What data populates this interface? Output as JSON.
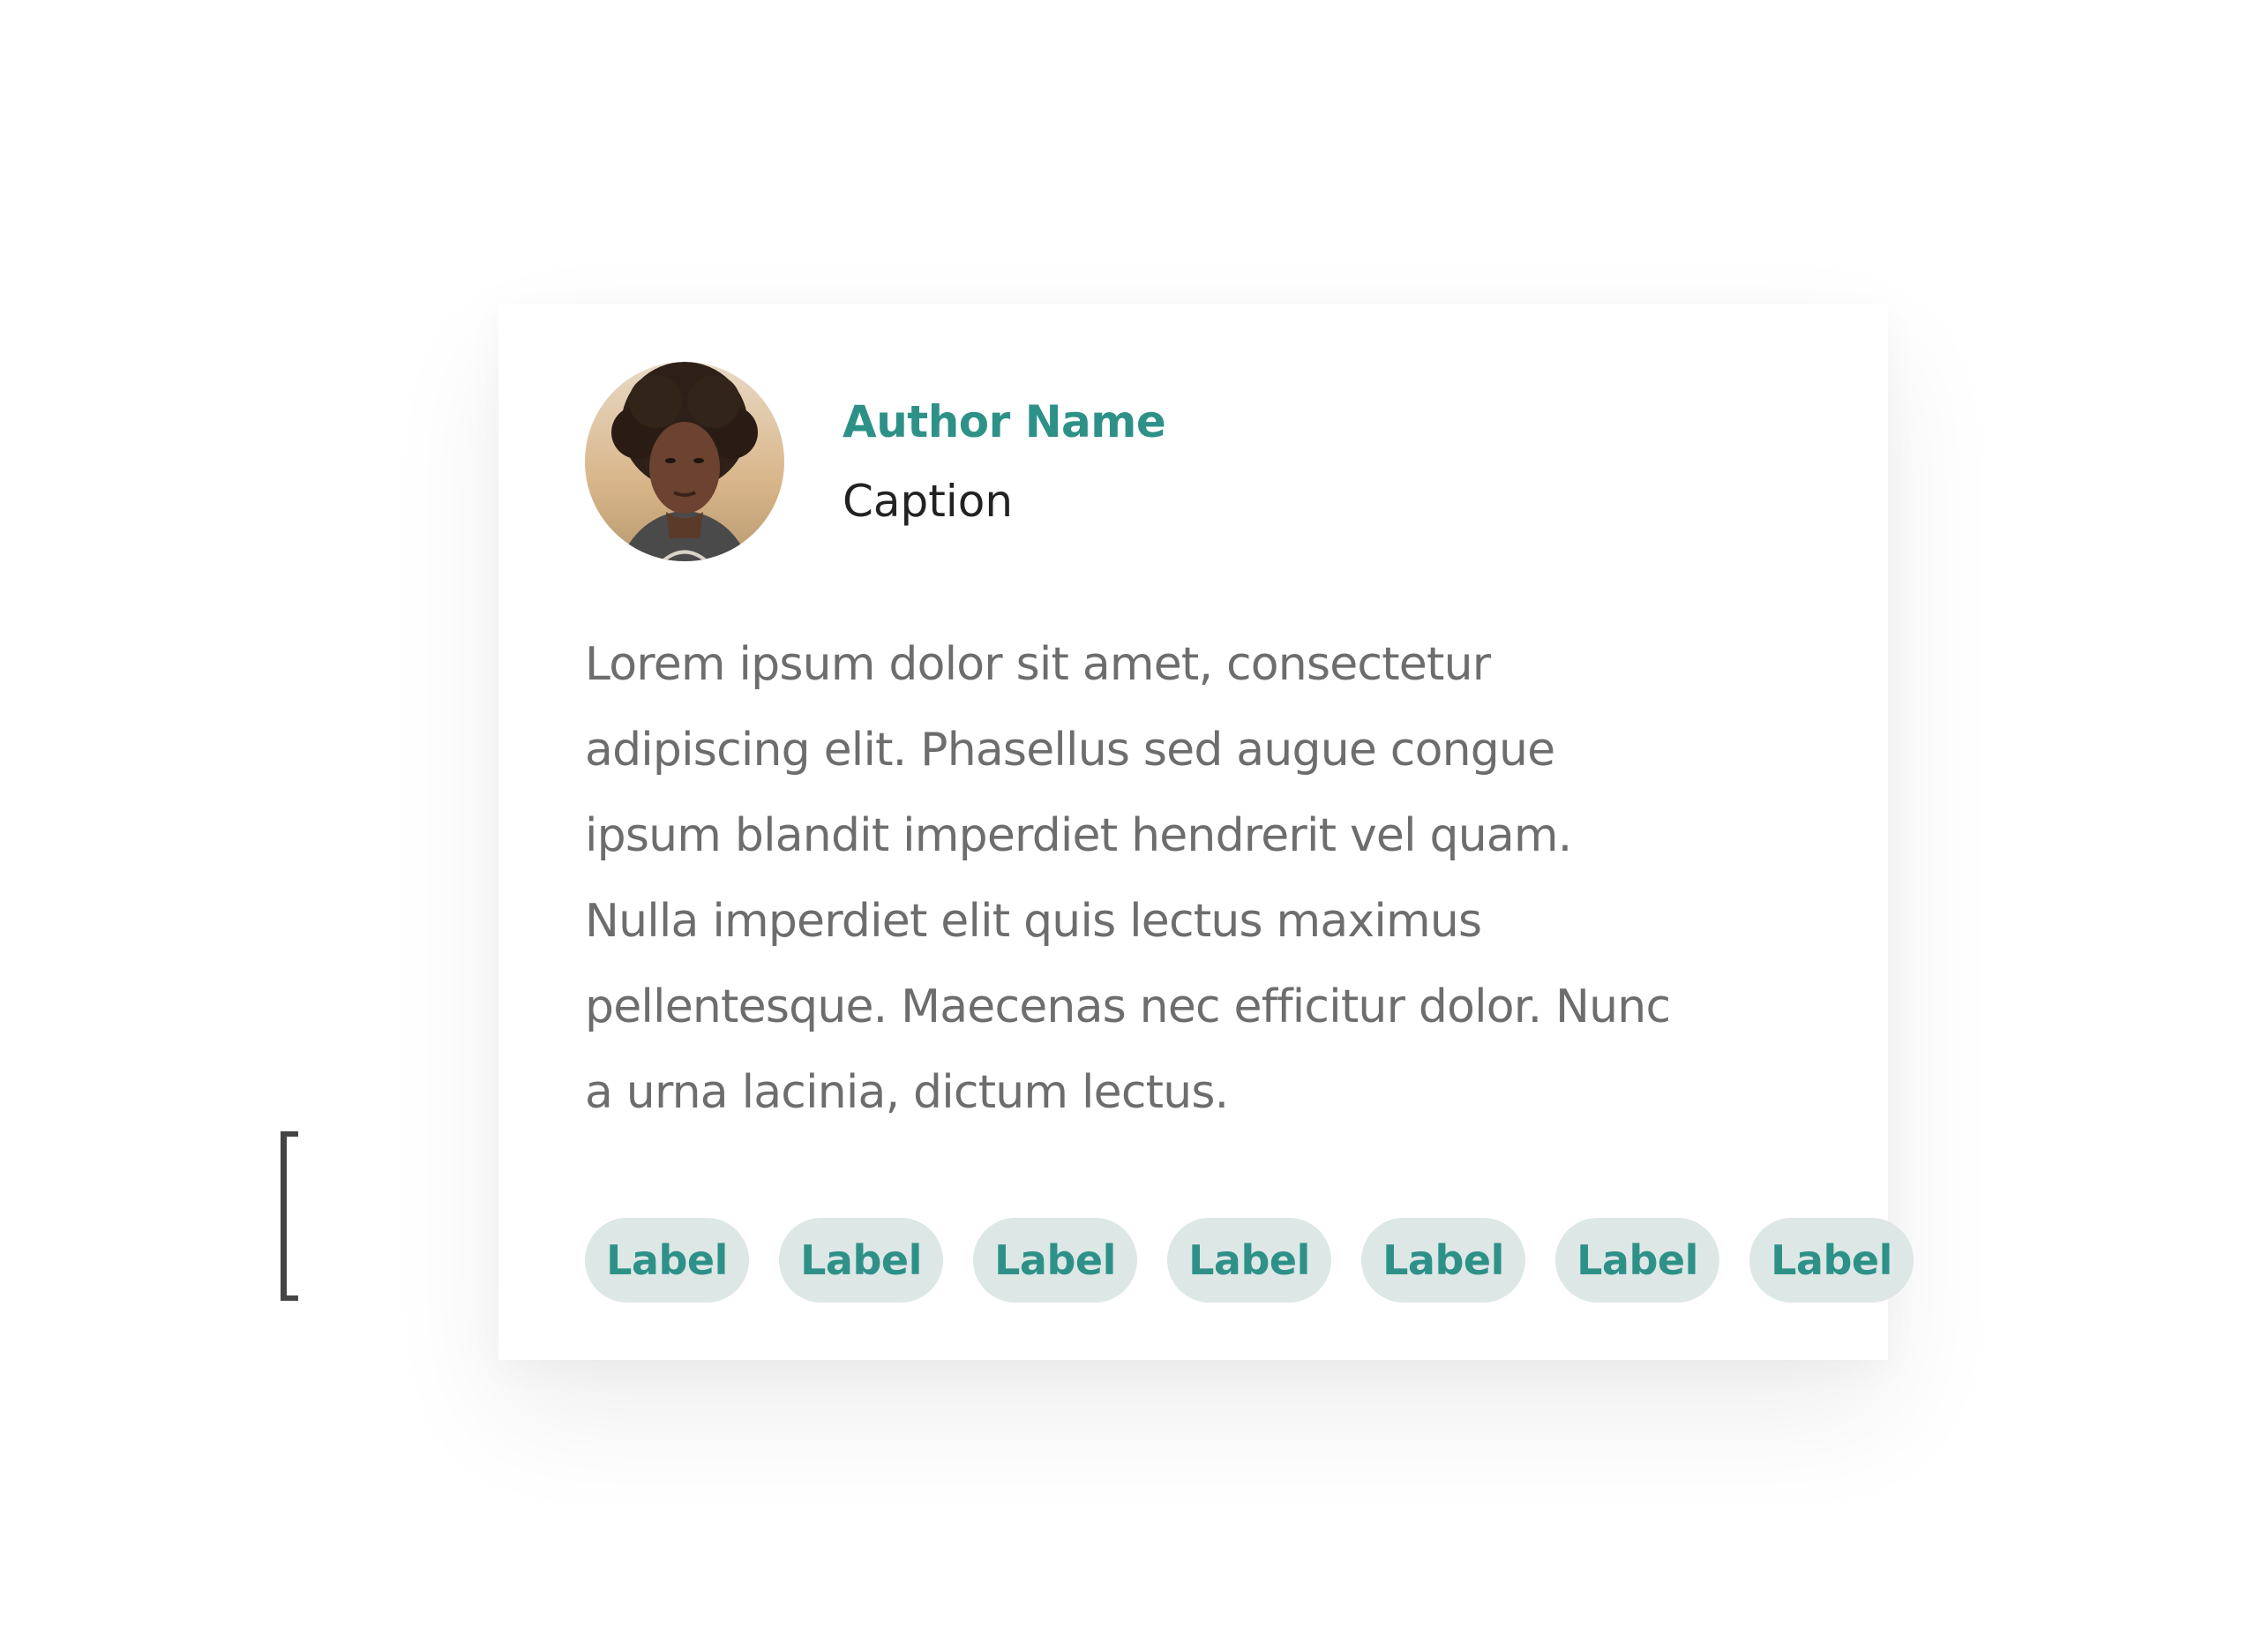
{
  "author": {
    "name": "Author Name",
    "caption": "Caption"
  },
  "body": {
    "lines": [
      "Lorem ipsum dolor sit amet, consectetur",
      "adipiscing elit. Phasellus sed augue congue",
      "ipsum blandit imperdiet hendrerit vel quam.",
      "Nulla imperdiet elit quis lectus maximus",
      "pellentesque. Maecenas nec efficitur dolor. Nunc",
      "a urna lacinia, dictum lectus."
    ]
  },
  "labels": [
    "Label",
    "Label",
    "Label",
    "Label",
    "Label",
    "Label",
    "Label"
  ],
  "colors": {
    "accent": "#2e9188",
    "chip_background": "#dde7e6",
    "body_text": "#6d6d6d",
    "caption_text": "#222222"
  }
}
